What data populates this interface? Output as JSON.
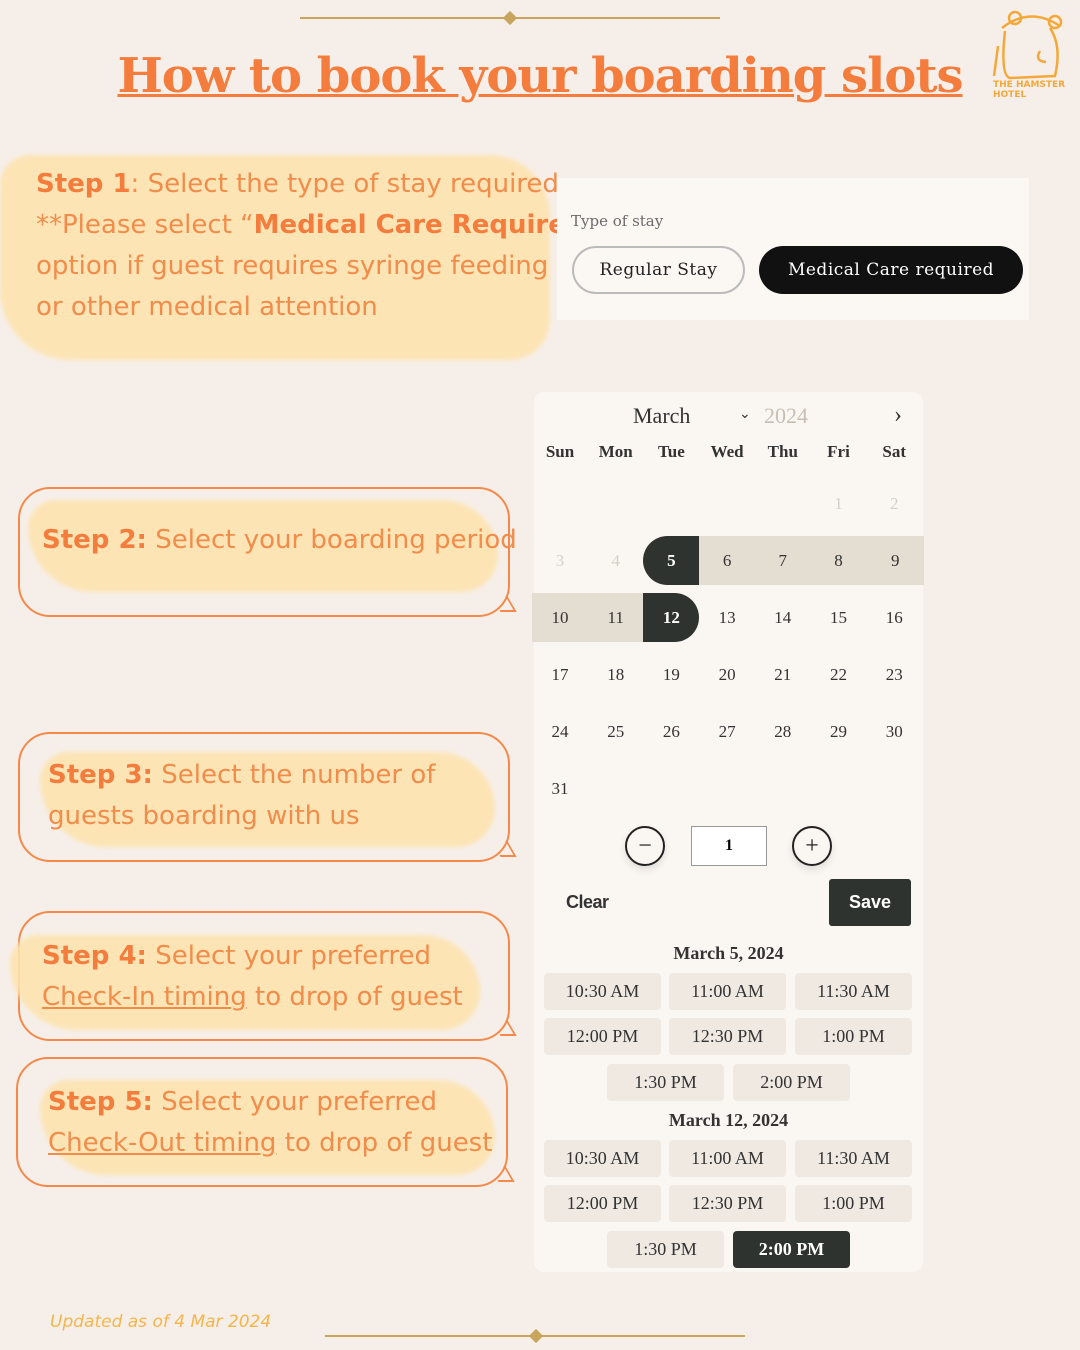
{
  "title": "How to book your boarding slots",
  "logo_text": "THE HAMSTER HOTEL",
  "steps": [
    {
      "label": "Step 1",
      "rest": ": Select the type of stay required.",
      "note_pre": "**Please select “",
      "note_bold": "Medical Care Required",
      "note_post": "”",
      "line3": "option if guest requires syringe feeding",
      "line4": "or other medical attention"
    },
    {
      "label": "Step 2:",
      "rest": " Select your boarding period"
    },
    {
      "label": "Step 3:",
      "rest": " Select the number of",
      "line2": "guests boarding with us"
    },
    {
      "label": "Step 4:",
      "rest": " Select your preferred",
      "link": "Check-In timing",
      "line2_rest": " to drop of guest"
    },
    {
      "label": "Step 5:",
      "rest": " Select your preferred",
      "link": "Check-Out timing",
      "line2_rest": " to drop of guest"
    }
  ],
  "stay": {
    "label": "Type of stay",
    "options": [
      "Regular Stay",
      "Medical Care required"
    ],
    "selected": "Medical Care required"
  },
  "calendar": {
    "month": "March",
    "year": "2024",
    "weekdays": [
      "Sun",
      "Mon",
      "Tue",
      "Wed",
      "Thu",
      "Fri",
      "Sat"
    ],
    "weeks": [
      [
        "",
        "",
        "",
        "",
        "",
        "1",
        "2"
      ],
      [
        "3",
        "4",
        "5",
        "6",
        "7",
        "8",
        "9"
      ],
      [
        "10",
        "11",
        "12",
        "13",
        "14",
        "15",
        "16"
      ],
      [
        "17",
        "18",
        "19",
        "20",
        "21",
        "22",
        "23"
      ],
      [
        "24",
        "25",
        "26",
        "27",
        "28",
        "29",
        "30"
      ],
      [
        "31",
        "",
        "",
        "",
        "",
        "",
        ""
      ]
    ],
    "disabled": [
      "1",
      "2",
      "3",
      "4"
    ],
    "range_start": "5",
    "range_end": "12",
    "guests": "1",
    "clear": "Clear",
    "save": "Save"
  },
  "checkin": {
    "date": "March 5, 2024",
    "slots": [
      "10:30 AM",
      "11:00 AM",
      "11:30 AM",
      "12:00 PM",
      "12:30 PM",
      "1:00 PM",
      "1:30 PM",
      "2:00 PM"
    ],
    "selected": null
  },
  "checkout": {
    "date": "March 12, 2024",
    "slots": [
      "10:30 AM",
      "11:00 AM",
      "11:30 AM",
      "12:00 PM",
      "12:30 PM",
      "1:00 PM",
      "1:30 PM",
      "2:00 PM"
    ],
    "selected": "2:00 PM"
  },
  "footer": "Updated as of 4 Mar 2024",
  "colors": {
    "accent": "#f47c3c",
    "highlight": "#fde3b0",
    "dark": "#2f3330",
    "range": "#e4ddd2"
  }
}
